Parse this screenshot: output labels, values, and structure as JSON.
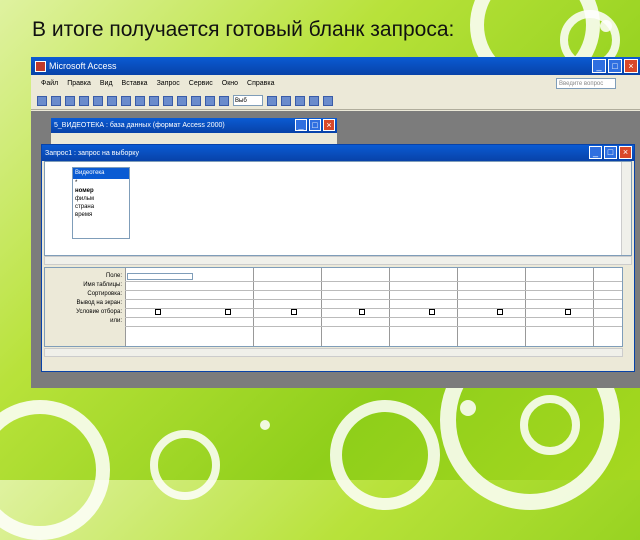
{
  "slide": {
    "title": "В итоге получается готовый бланк запроса:"
  },
  "app": {
    "title": "Microsoft Access",
    "menu": [
      "Файл",
      "Правка",
      "Вид",
      "Вставка",
      "Запрос",
      "Сервис",
      "Окно",
      "Справка"
    ],
    "help_placeholder": "Введите вопрос",
    "toolbar_select": "Выб",
    "min_glyph": "_",
    "max_glyph": "□",
    "close_glyph": "×"
  },
  "db_window": {
    "title": "5_ВИДЕОТЕКА : база данных (формат Access 2000)"
  },
  "query_window": {
    "title": "Запрос1 : запрос на выборку",
    "table": {
      "name": "Видеотека",
      "fields": [
        "*",
        "номер",
        "фильм",
        "страна",
        "время"
      ]
    },
    "grid_rows": [
      "Поле:",
      "Имя таблицы:",
      "Сортировка:",
      "Вывод на экран:",
      "Условие отбора:",
      "или:"
    ]
  }
}
